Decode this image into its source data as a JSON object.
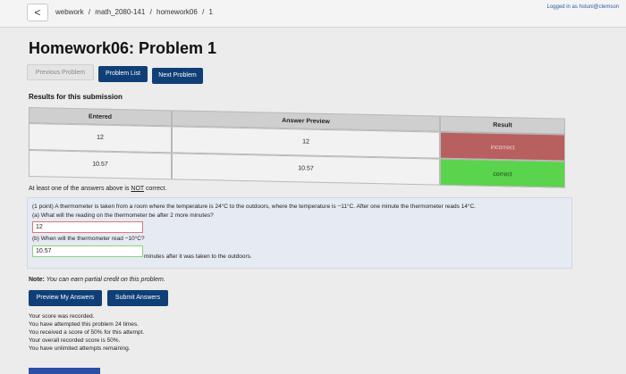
{
  "topbar": {
    "back_label": "<",
    "breadcrumb": [
      "webwork",
      "/",
      "math_2080-141",
      "/",
      "homework06",
      "/",
      "1"
    ],
    "logged_in": "Logged in as hstuni@clemson"
  },
  "page_title": "Homework06: Problem 1",
  "nav": {
    "previous": "Previous Problem",
    "list": "Problem List",
    "next": "Next Problem"
  },
  "results": {
    "title": "Results for this submission",
    "headers": [
      "Entered",
      "Answer Preview",
      "Result"
    ],
    "rows": [
      {
        "entered": "12",
        "preview": "12",
        "result": "incorrect"
      },
      {
        "entered": "10.57",
        "preview": "10.57",
        "result": "correct"
      }
    ],
    "warning_prefix": "At least one of the answers above is ",
    "warning_not": "NOT",
    "warning_suffix": " correct."
  },
  "colors": {
    "incorrect": "#b85f5f",
    "correct": "#5ad44c",
    "button": "#0f3f76"
  },
  "problem": {
    "intro": "(1 point) A thermometer is taken from a room where the temperature is 24°C to the outdoors, where the temperature is −11°C. After one minute the thermometer reads 14°C.",
    "part_a": "(a) What will the reading on the thermometer be after 2 more minutes?",
    "answer_a": "12",
    "part_b": "(b) When will the thermometer read −10°C?",
    "answer_b": "10.57",
    "part_b_suffix": "minutes after it was taken to the outdoors."
  },
  "note": {
    "label": "Note:",
    "text": " You can earn partial credit on this problem."
  },
  "actions": {
    "preview": "Preview My Answers",
    "submit": "Submit Answers"
  },
  "status": [
    "Your score was recorded.",
    "You have attempted this problem 24 times.",
    "You received a score of 50% for this attempt.",
    "Your overall recorded score is 50%.",
    "You have unlimited attempts remaining."
  ]
}
